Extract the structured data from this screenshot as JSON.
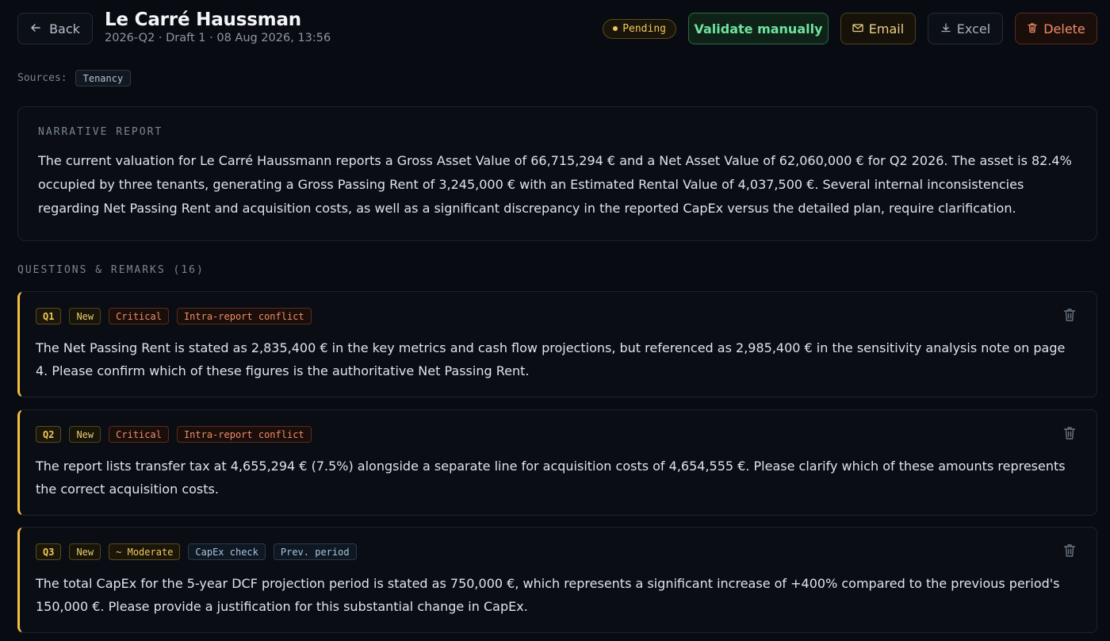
{
  "header": {
    "back_label": "Back",
    "title": "Le Carré Haussman",
    "subtitle": "2026-Q2 · Draft 1 · 08 Aug 2026, 13:56",
    "status": "Pending",
    "validate_label": "Validate manually",
    "email_label": "Email",
    "excel_label": "Excel",
    "delete_label": "Delete"
  },
  "sources": {
    "label": "Sources:",
    "items": [
      "Tenancy"
    ]
  },
  "narrative": {
    "label": "NARRATIVE REPORT",
    "text": "The current valuation for Le Carré Haussmann reports a Gross Asset Value of 66,715,294 € and a Net Asset Value of 62,060,000 € for Q2 2026. The asset is 82.4% occupied by three tenants, generating a Gross Passing Rent of 3,245,000 € with an Estimated Rental Value of 4,037,500 €. Several internal inconsistencies regarding Net Passing Rent and acquisition costs, as well as a significant discrepancy in the reported CapEx versus the detailed plan, require clarification."
  },
  "questions": {
    "label": "QUESTIONS & REMARKS (16)",
    "items": [
      {
        "id": "Q1",
        "status": "New",
        "severity": "Critical",
        "tags": [
          "Intra-report conflict"
        ],
        "text": "The Net Passing Rent is stated as 2,835,400 € in the key metrics and cash flow projections, but referenced as 2,985,400 € in the sensitivity analysis note on page 4. Please confirm which of these figures is the authoritative Net Passing Rent."
      },
      {
        "id": "Q2",
        "status": "New",
        "severity": "Critical",
        "tags": [
          "Intra-report conflict"
        ],
        "text": "The report lists transfer tax at 4,655,294 € (7.5%) alongside a separate line for acquisition costs of 4,654,555 €. Please clarify which of these amounts represents the correct acquisition costs."
      },
      {
        "id": "Q3",
        "status": "New",
        "severity": "~ Moderate",
        "tags": [
          "CapEx check",
          "Prev. period"
        ],
        "text": "The total CapEx for the 5-year DCF projection period is stated as 750,000 €, which represents a significant increase of +400% compared to the previous period's 150,000 €. Please provide a justification for this substantial change in CapEx."
      }
    ]
  },
  "colors": {
    "accent_yellow": "#f0c040",
    "validate_green": "#6fe3a0",
    "delete_red": "#f08c6a"
  }
}
